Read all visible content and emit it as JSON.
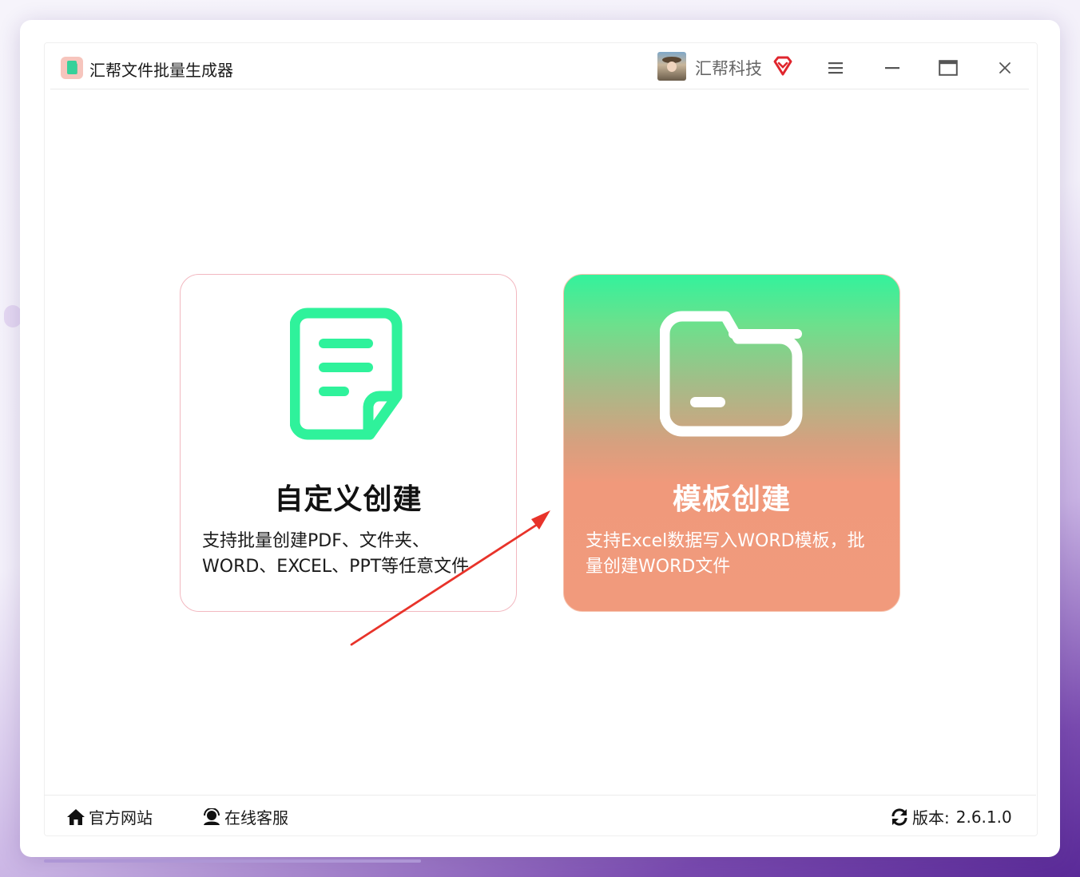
{
  "app": {
    "title": "汇帮文件批量生成器"
  },
  "user": {
    "name": "汇帮科技"
  },
  "cards": {
    "custom": {
      "title": "自定义创建",
      "desc_line1": "支持批量创建PDF、文件夹、",
      "desc_line2": "WORD、EXCEL、PPT等任意文件"
    },
    "template": {
      "title": "模板创建",
      "desc_line1": "支持Excel数据写入WORD模板，批",
      "desc_line2": "量创建WORD文件"
    }
  },
  "footer": {
    "website": "官方网站",
    "support": "在线客服",
    "version_label": "版本:",
    "version": "2.6.1.0"
  },
  "colors": {
    "accent_green": "#2ff29b",
    "accent_coral": "#f19a7c",
    "arrow_red": "#e8332a",
    "vip_red": "#e0262e"
  },
  "icons": [
    "app-logo-icon",
    "vip-diamond-icon",
    "menu-icon",
    "minimize-icon",
    "maximize-icon",
    "close-icon",
    "document-icon",
    "folder-icon",
    "home-icon",
    "customer-service-icon",
    "refresh-icon"
  ]
}
